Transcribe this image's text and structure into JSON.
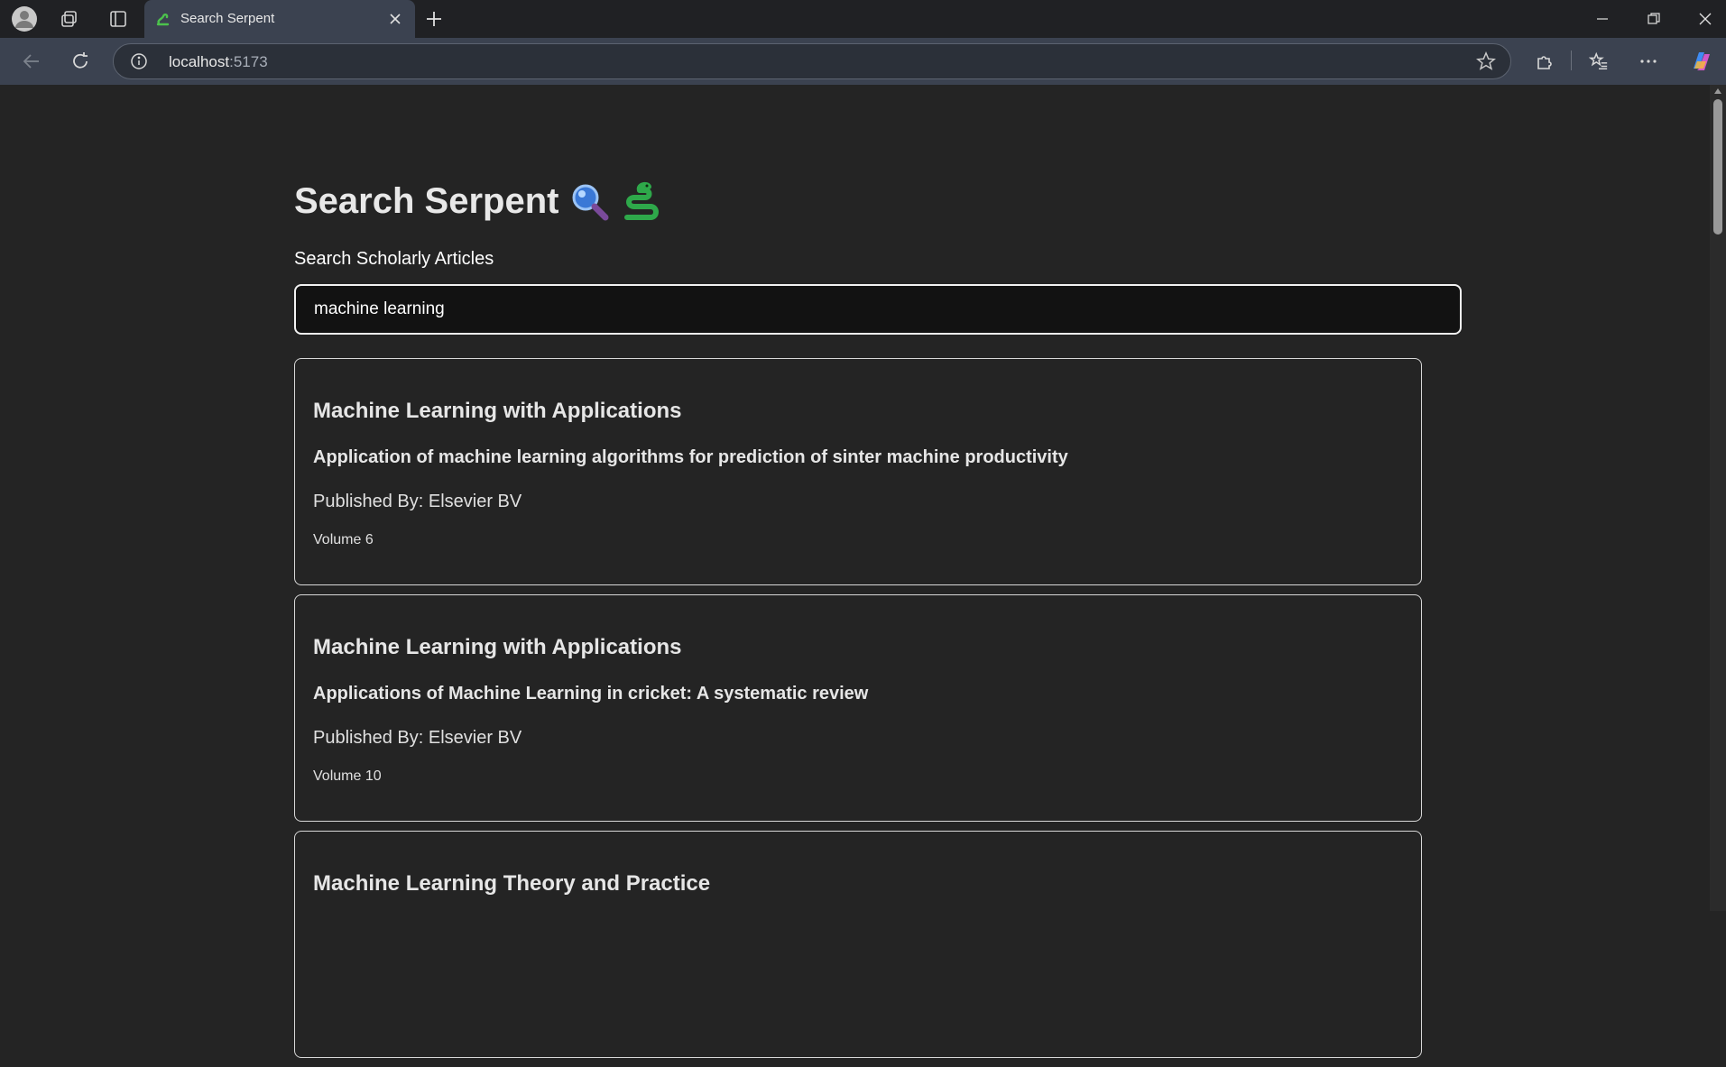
{
  "browser": {
    "tab_title": "Search Serpent",
    "url_host": "localhost",
    "url_port": ":5173"
  },
  "app": {
    "title": "Search Serpent",
    "title_emoji": [
      "magnifying-glass",
      "snake"
    ],
    "search_label": "Search Scholarly Articles",
    "search_value": "machine learning"
  },
  "results": [
    {
      "journal": "Machine Learning with Applications",
      "title": "Application of machine learning algorithms for prediction of sinter machine productivity",
      "publisher": "Published By: Elsevier BV",
      "volume": "Volume 6"
    },
    {
      "journal": "Machine Learning with Applications",
      "title": "Applications of Machine Learning in cricket: A systematic review",
      "publisher": "Published By: Elsevier BV",
      "volume": "Volume 10"
    },
    {
      "journal": "Machine Learning Theory and Practice",
      "title": "",
      "publisher": "",
      "volume": ""
    }
  ],
  "colors": {
    "page_bg": "#242424",
    "chrome_bg": "#3b4250",
    "text": "#e6e6e6"
  }
}
